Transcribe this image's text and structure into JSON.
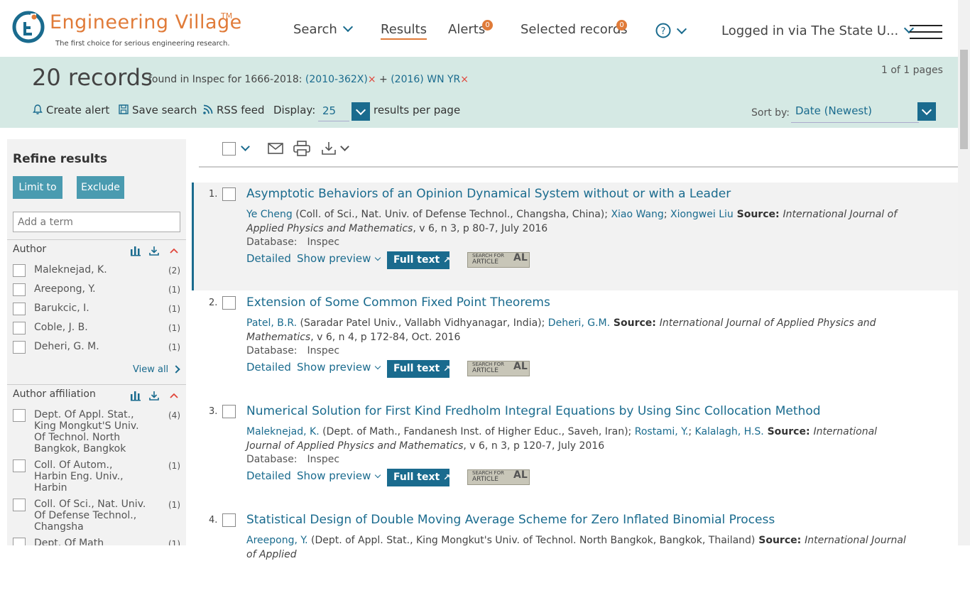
{
  "header": {
    "logo_title": "Engineering Village",
    "logo_tm": "TM",
    "logo_tagline": "The first choice for serious engineering research.",
    "nav": {
      "search": "Search",
      "results": "Results",
      "alerts": "Alerts",
      "alerts_badge": "0",
      "selected": "Selected records",
      "selected_badge": "0",
      "help": "?",
      "login": "Logged in via The State U..."
    }
  },
  "banner": {
    "count": "20 records",
    "found_text": "found in Inspec for 1666-2018:",
    "term1": "(2010-362X)",
    "plus": "+",
    "term2": "(2016) WN YR",
    "remove": "×",
    "pages": "1 of 1 pages",
    "create_alert": "Create alert",
    "save_search": "Save search",
    "rss": "RSS feed",
    "display_label": "Display:",
    "display_value": "25",
    "per_page": "results per page",
    "sort_label": "Sort by:",
    "sort_value": "Date (Newest)"
  },
  "sidebar": {
    "title": "Refine results",
    "limit": "Limit to",
    "exclude": "Exclude",
    "add_term_placeholder": "Add a term",
    "author_head": "Author",
    "authors": [
      {
        "name": "Maleknejad, K.",
        "count": "(2)"
      },
      {
        "name": "Areepong, Y.",
        "count": "(1)"
      },
      {
        "name": "Barukcic, I.",
        "count": "(1)"
      },
      {
        "name": "Coble, J. B.",
        "count": "(1)"
      },
      {
        "name": "Deheri, G. M.",
        "count": "(1)"
      }
    ],
    "view_all": "View all",
    "affil_head": "Author affiliation",
    "affils": [
      {
        "name": "Dept. Of Appl. Stat., King Mongkut'S Univ. Of Technol. North Bangkok, Bangkok",
        "count": "(4)"
      },
      {
        "name": "Coll. Of Autom., Harbin Eng. Univ., Harbin",
        "count": "(1)"
      },
      {
        "name": "Coll. Of Sci., Nat. Univ. Of Defense Technol., Changsha",
        "count": "(1)"
      },
      {
        "name": "Dept. Of Math",
        "count": "(1)"
      }
    ]
  },
  "results": [
    {
      "num": "1.",
      "title": "Asymptotic Behaviors of an Opinion Dynamical System without or with a Leader",
      "a1": "Ye Cheng",
      "aff1": " (Coll. of Sci., Nat. Univ. of Defense Technol., Changsha, China); ",
      "a2": "Xiao Wang",
      "sep": "; ",
      "a3": "Xiongwei Liu",
      "src_label": " Source: ",
      "journal": "International Journal of Applied Physics and Mathematics",
      "details": ", v 6, n 3, p 80-7, July 2016"
    },
    {
      "num": "2.",
      "title": "Extension of Some Common Fixed Point Theorems",
      "a1": "Patel, B.R.",
      "aff1": " (Saradar Patel Univ., Vallabh Vidhyanagar, India); ",
      "a2": "Deheri, G.M.",
      "sep": "",
      "a3": "",
      "src_label": " Source: ",
      "journal": "International Journal of Applied Physics and Mathematics",
      "details": ", v 6, n 4, p 172-84, Oct. 2016"
    },
    {
      "num": "3.",
      "title": "Numerical Solution for First Kind Fredholm Integral Equations by Using Sinc Collocation Method",
      "a1": "Maleknejad, K.",
      "aff1": " (Dept. of Math., Fandanesh Inst. of Higher Educ., Saveh, Iran); ",
      "a2": "Rostami, Y.",
      "sep": "; ",
      "a3": "Kalalagh, H.S.",
      "src_label": " Source: ",
      "journal": "International Journal of Applied Physics and Mathematics",
      "details": ", v 6, n 3, p 120-7, July 2016"
    },
    {
      "num": "4.",
      "title": "Statistical Design of Double Moving Average Scheme for Zero Inflated Binomial Process",
      "a1": "Areepong, Y.",
      "aff1": " (Dept. of Appl. Stat., King Mongkut's Univ. of Technol. North Bangkok, Bangkok, Thailand)",
      "a2": "",
      "sep": "",
      "a3": "",
      "src_label": " Source: ",
      "journal": "International Journal of Applied",
      "details": ""
    }
  ],
  "result_common": {
    "db_label": "Database:",
    "db_value": "Inspec",
    "detailed": "Detailed",
    "preview": "Show preview",
    "full_text": "Full text",
    "afl_line1": "SEARCH FOR",
    "afl_line2": "ARTICLE",
    "afl_big": "AL"
  },
  "colors": {
    "accent": "#1a6b8e",
    "brand_orange": "#e07b39",
    "banner_bg": "#d5e9e4"
  }
}
